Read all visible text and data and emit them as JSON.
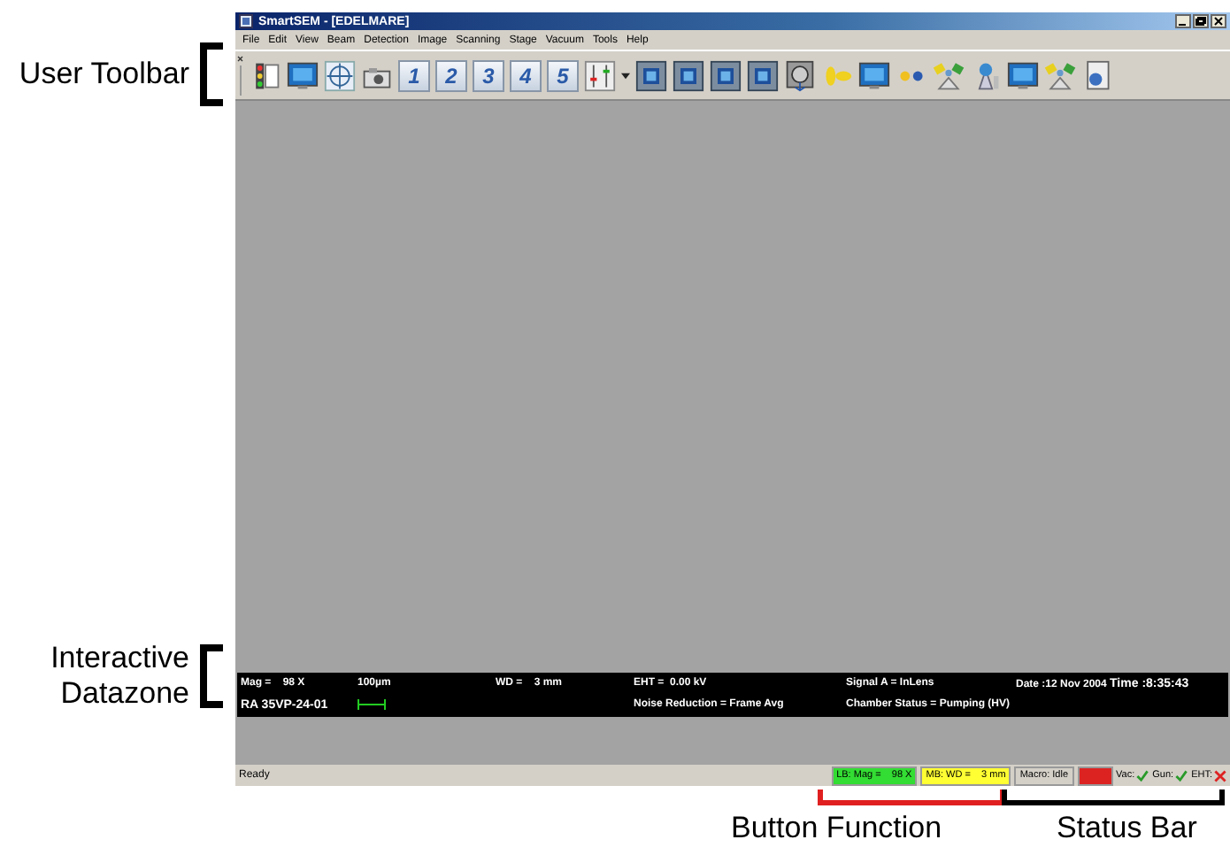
{
  "annotations": {
    "toolbar": "User Toolbar",
    "datazone": "Interactive Datazone",
    "button_function": "Button Function",
    "status_bar": "Status Bar"
  },
  "window": {
    "title": "SmartSEM - [EDELMARE]"
  },
  "menu": [
    "File",
    "Edit",
    "View",
    "Beam",
    "Detection",
    "Image",
    "Scanning",
    "Stage",
    "Vacuum",
    "Tools",
    "Help"
  ],
  "toolbar": [
    {
      "kind": "traffic"
    },
    {
      "kind": "screen"
    },
    {
      "kind": "target"
    },
    {
      "kind": "camera"
    },
    {
      "kind": "number",
      "label": "1"
    },
    {
      "kind": "number",
      "label": "2"
    },
    {
      "kind": "number",
      "label": "3"
    },
    {
      "kind": "number",
      "label": "4"
    },
    {
      "kind": "number",
      "label": "5"
    },
    {
      "kind": "sliders"
    },
    {
      "kind": "caret"
    },
    {
      "kind": "image"
    },
    {
      "kind": "image"
    },
    {
      "kind": "image"
    },
    {
      "kind": "image"
    },
    {
      "kind": "dial"
    },
    {
      "kind": "beam"
    },
    {
      "kind": "screen"
    },
    {
      "kind": "dots"
    },
    {
      "kind": "satellite"
    },
    {
      "kind": "tower"
    },
    {
      "kind": "screen"
    },
    {
      "kind": "satellite"
    },
    {
      "kind": "document"
    }
  ],
  "datazone": {
    "row1": [
      "Mag =    98 X",
      "100µm",
      "WD =    3 mm",
      "EHT =  0.00 kV",
      "Signal A = InLens",
      "Date :12 Nov 2004",
      "Time :8:35:43"
    ],
    "row2": {
      "id": "RA 35VP-24-01",
      "noise": "Noise Reduction = Frame Avg",
      "chamber": "Chamber Status = Pumping (HV)"
    }
  },
  "status_bar": {
    "text": "Ready",
    "panels": [
      {
        "kind": "text",
        "text": "LB: Mag =    98 X",
        "color": "#33dd33"
      },
      {
        "kind": "text",
        "text": "MB: WD =    3 mm",
        "color": "#ffff33"
      },
      {
        "kind": "text",
        "text": "Macro: Idle"
      },
      {
        "kind": "block",
        "color": "#dd2222"
      },
      {
        "kind": "check",
        "text": "Vac:",
        "ok": true
      },
      {
        "kind": "check",
        "text": "Gun:",
        "ok": true
      },
      {
        "kind": "check",
        "text": "EHT:",
        "ok": false
      }
    ]
  }
}
